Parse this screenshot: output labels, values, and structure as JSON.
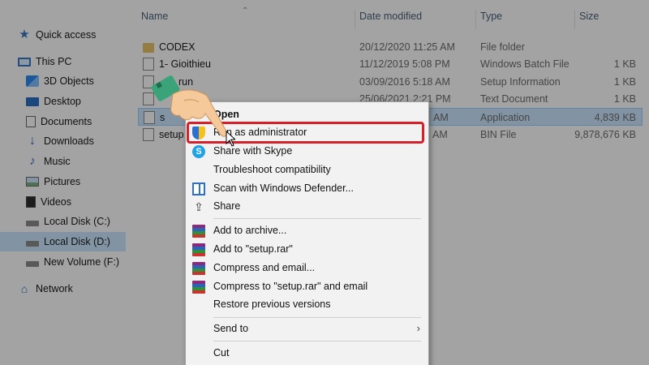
{
  "nav": {
    "items": [
      {
        "label": "Quick access",
        "icon": "star-icon"
      },
      {
        "label": "This PC",
        "icon": "computer-icon"
      },
      {
        "label": "3D Objects",
        "icon": "3d-objects-icon"
      },
      {
        "label": "Desktop",
        "icon": "desktop-icon"
      },
      {
        "label": "Documents",
        "icon": "documents-icon"
      },
      {
        "label": "Downloads",
        "icon": "downloads-icon"
      },
      {
        "label": "Music",
        "icon": "music-icon"
      },
      {
        "label": "Pictures",
        "icon": "pictures-icon"
      },
      {
        "label": "Videos",
        "icon": "videos-icon"
      },
      {
        "label": "Local Disk (C:)",
        "icon": "drive-icon"
      },
      {
        "label": "Local Disk (D:)",
        "icon": "drive-icon"
      },
      {
        "label": "New Volume (F:)",
        "icon": "drive-icon"
      },
      {
        "label": "Network",
        "icon": "network-icon"
      }
    ]
  },
  "columns": {
    "name": "Name",
    "date": "Date modified",
    "type": "Type",
    "size": "Size"
  },
  "files": [
    {
      "name": "CODEX",
      "date": "20/12/2020 11:25 AM",
      "type": "File folder",
      "size": "",
      "icon": "folder-icon"
    },
    {
      "name": "1- Gioithieu",
      "date": "11/12/2019 5:08 PM",
      "type": "Windows Batch File",
      "size": "1 KB",
      "icon": "batch-file-icon"
    },
    {
      "name": "run",
      "date": "03/09/2016 5:18 AM",
      "type": "Setup Information",
      "size": "1 KB",
      "icon": "setup-info-icon"
    },
    {
      "name": "",
      "date": "25/06/2021 2:21 PM",
      "type": "Text Document",
      "size": "1 KB",
      "icon": "text-file-icon"
    },
    {
      "name": "s",
      "date": "AM",
      "type": "Application",
      "size": "4,839 KB",
      "icon": "application-icon"
    },
    {
      "name": "setup",
      "date": "AM",
      "type": "BIN File",
      "size": "9,878,676 KB",
      "icon": "bin-file-icon"
    }
  ],
  "context_menu": {
    "items": [
      {
        "label": "Open",
        "bold": true,
        "icon": ""
      },
      {
        "label": "Run as administrator",
        "icon": "uac-shield-icon"
      },
      {
        "label": "Share with Skype",
        "icon": "skype-icon"
      },
      {
        "label": "Troubleshoot compatibility",
        "icon": ""
      },
      {
        "label": "Scan with Windows Defender...",
        "icon": "defender-icon"
      },
      {
        "label": "Share",
        "icon": "share-icon"
      },
      {
        "label": "Add to archive...",
        "icon": "winrar-icon"
      },
      {
        "label": "Add to \"setup.rar\"",
        "icon": "winrar-icon"
      },
      {
        "label": "Compress and email...",
        "icon": "winrar-icon"
      },
      {
        "label": "Compress to \"setup.rar\" and email",
        "icon": "winrar-icon"
      },
      {
        "label": "Restore previous versions",
        "icon": ""
      },
      {
        "label": "Send to",
        "icon": "",
        "submenu": true
      },
      {
        "label": "Cut",
        "icon": ""
      }
    ]
  },
  "colors": {
    "highlight": "#d6212b",
    "selection": "#cce8ff",
    "hand_skin": "#f5c99a",
    "cuff": "#3aa37a"
  }
}
